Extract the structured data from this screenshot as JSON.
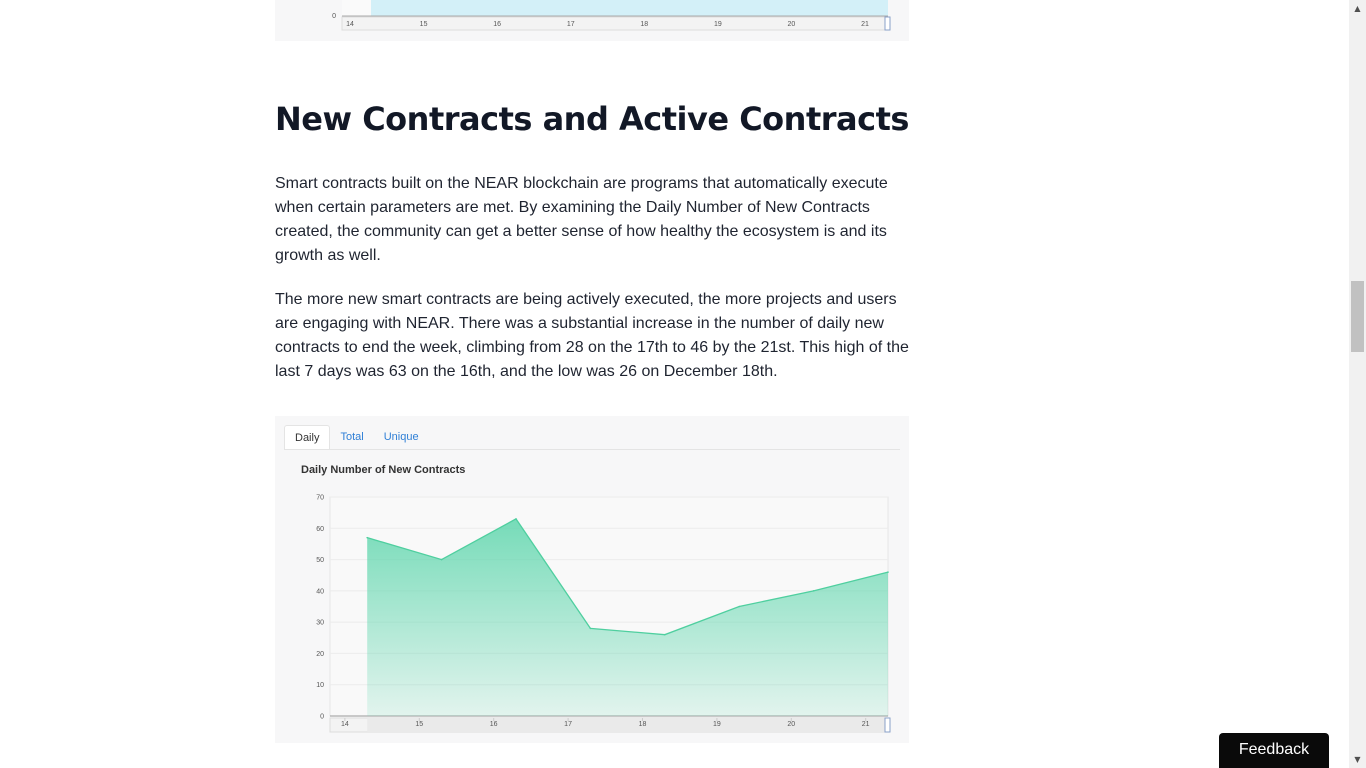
{
  "heading": "New Contracts and Active Contracts",
  "paragraphs": {
    "p1": "Smart contracts built on the NEAR blockchain are programs that automatically execute when certain parameters are met. By examining the Daily Number of New Contracts created, the community can get a better sense of how healthy the ecosystem is and its growth as well.",
    "p2": "The more new smart contracts are being actively executed, the more projects and users are engaging with NEAR. There was a substantial increase in the number of daily new contracts to end the week, climbing from 28 on the 17th to 46 by the 21st. This high of the last 7 days  was 63 on the 16th, and the low was 26 on December 18th."
  },
  "top_chart": {
    "y_tick": "0",
    "x_ticks": [
      "14",
      "15",
      "16",
      "17",
      "18",
      "19",
      "20",
      "21"
    ],
    "fill_color": "#d3f0f8"
  },
  "tabs": [
    "Daily",
    "Total",
    "Unique"
  ],
  "active_tab": "Daily",
  "chart_data": {
    "type": "area",
    "title": "Daily Number of New Contracts",
    "x": [
      "14",
      "15",
      "16",
      "17",
      "18",
      "19",
      "20",
      "21"
    ],
    "points": [
      {
        "x": 14.3,
        "y": 57
      },
      {
        "x": 15.3,
        "y": 50
      },
      {
        "x": 16.3,
        "y": 63
      },
      {
        "x": 17.3,
        "y": 28
      },
      {
        "x": 18.3,
        "y": 26
      },
      {
        "x": 19.3,
        "y": 35
      },
      {
        "x": 20.3,
        "y": 40
      },
      {
        "x": 21.3,
        "y": 46
      }
    ],
    "y_ticks": [
      0,
      10,
      20,
      30,
      40,
      50,
      60,
      70
    ],
    "ylim": [
      0,
      70
    ],
    "xlim": [
      13.8,
      21.3
    ],
    "color": "#5fd6ad",
    "grid": true
  },
  "feedback_label": "Feedback",
  "scroll_icons": {
    "up": "▲",
    "down": "▼"
  }
}
